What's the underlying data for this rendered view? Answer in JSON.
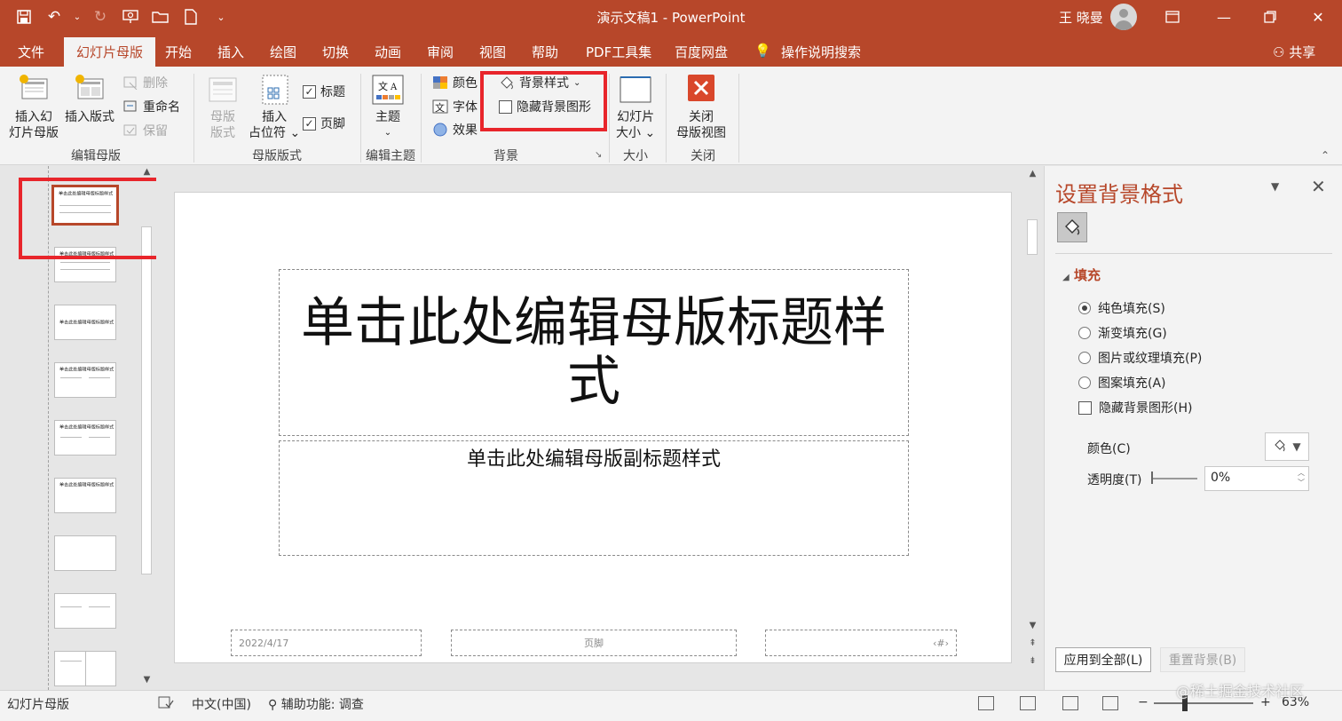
{
  "window": {
    "title": "演示文稿1 - PowerPoint",
    "user": "王 晓曼",
    "accent": "#b7472a"
  },
  "qat": {
    "save_icon": "save-icon",
    "undo_icon": "undo-icon",
    "redo_icon": "redo-icon",
    "present_icon": "present-icon",
    "open_icon": "open-folder-icon",
    "new_icon": "new-document-icon"
  },
  "tabs": {
    "file": "文件",
    "slide_master": "幻灯片母版",
    "home": "开始",
    "insert": "插入",
    "draw": "绘图",
    "transitions": "切换",
    "animations": "动画",
    "review": "审阅",
    "view": "视图",
    "help": "帮助",
    "pdf": "PDF工具集",
    "baidu": "百度网盘",
    "tell_me": "操作说明搜索",
    "share": "共享"
  },
  "ribbon": {
    "edit_master": {
      "label": "编辑母版",
      "insert_slide_master_1": "插入幻",
      "insert_slide_master_2": "灯片母版",
      "insert_layout": "插入版式",
      "delete": "删除",
      "rename": "重命名",
      "preserve": "保留"
    },
    "master_layout": {
      "label": "母版版式",
      "master_layout_1": "母版",
      "master_layout_2": "版式",
      "insert_placeholder_1": "插入",
      "insert_placeholder_2": "占位符",
      "title_check": "标题",
      "footer_check": "页脚"
    },
    "edit_theme": {
      "label": "编辑主题",
      "themes": "主题"
    },
    "background": {
      "label": "背景",
      "colors": "颜色",
      "fonts": "字体",
      "effects": "效果",
      "background_styles": "背景样式",
      "hide_background_graphics": "隐藏背景图形"
    },
    "size": {
      "label": "大小",
      "slide_size_1": "幻灯片",
      "slide_size_2": "大小"
    },
    "close": {
      "label": "关闭",
      "close_master_1": "关闭",
      "close_master_2": "母版视图"
    }
  },
  "thumbnails": [
    {
      "title": "单击此处编辑母版标题样式",
      "selected": true
    },
    {
      "title": "单击此处编辑母版标题样式",
      "selected": false
    },
    {
      "title": "单击此处编辑母版标题样式",
      "selected": false
    },
    {
      "title": "单击此处编辑母版标题样式",
      "selected": false
    },
    {
      "title": "单击此处编辑母版标题样式",
      "selected": false
    },
    {
      "title": "单击此处编辑母版标题样式",
      "selected": false
    },
    {
      "title": "",
      "selected": false
    },
    {
      "title": "",
      "selected": false
    },
    {
      "title": "",
      "selected": false
    }
  ],
  "slide": {
    "title": "单击此处编辑母版标题样式",
    "subtitle": "单击此处编辑母版副标题样式",
    "date": "2022/4/17",
    "footer": "页脚",
    "slide_number": "‹#›"
  },
  "format_pane": {
    "title": "设置背景格式",
    "fill_header": "填充",
    "options": {
      "solid": "纯色填充(S)",
      "gradient": "渐变填充(G)",
      "picture": "图片或纹理填充(P)",
      "pattern": "图案填充(A)",
      "hide_graphics": "隐藏背景图形(H)"
    },
    "selected_fill": "solid",
    "color_label": "颜色(C)",
    "transparency_label": "透明度(T)",
    "transparency_value": "0%",
    "apply_all": "应用到全部(L)",
    "reset": "重置背景(B)"
  },
  "statusbar": {
    "view_name": "幻灯片母版",
    "language": "中文(中国)",
    "accessibility": "辅助功能: 调查",
    "zoom_minus": "−",
    "zoom_plus": "+",
    "zoom": "63%"
  },
  "watermark": "@稀土掘金技术社区"
}
